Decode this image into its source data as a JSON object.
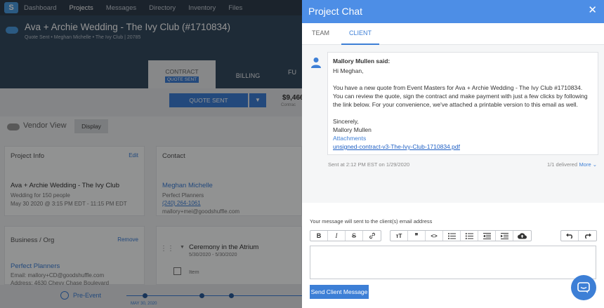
{
  "nav": {
    "items": [
      "Dashboard",
      "Projects",
      "Messages",
      "Directory",
      "Inventory",
      "Files"
    ],
    "active": "Projects"
  },
  "project": {
    "title": "Ava + Archie Wedding - The Ivy Club (#1710834)",
    "subtitle": "Quote Sent  •  Meghan Michelle  •  The Ivy Club | 20785",
    "tab_contract": "CONTRACT",
    "tab_contract_badge": "QUOTE SENT",
    "tab_billing": "BILLING",
    "tab_fu": "FU",
    "quote_button": "QUOTE SENT",
    "price": "$9,466",
    "price_sub": "Contrac",
    "vendor_view": "Vendor View",
    "display_button": "Display"
  },
  "project_info": {
    "heading": "Project Info",
    "edit": "Edit",
    "event_name": "Ava + Archie Wedding - The Ivy Club",
    "guests": "Wedding for 150 people",
    "datetime": "May 30 2020 @ 3:15 PM EDT - 11:15 PM EDT"
  },
  "contact": {
    "heading": "Contact",
    "name": "Meghan Michelle",
    "company": "Perfect Planners",
    "phone": "(240) 264-1061",
    "email": "mallory+mei@goodshuffle.com"
  },
  "business": {
    "heading": "Business / Org",
    "remove": "Remove",
    "name": "Perfect Planners",
    "email": "Email: mallory+CD@goodshuffle.com",
    "address": "Address: 4630 Chevy Chase Boulevard"
  },
  "ceremony": {
    "title": "Ceremony in the Atrium",
    "dates": "5/30/2020 - 5/30/2020",
    "item_label": "Item"
  },
  "timeline": {
    "stage": "Pre-Event",
    "date": "MAY 30, 2020"
  },
  "chat": {
    "title": "Project Chat",
    "tabs": [
      "TEAM",
      "CLIENT"
    ],
    "active_tab": "CLIENT",
    "message": {
      "sender": "Mallory Mullen said:",
      "greeting": "Hi Meghan,",
      "body": "You have a new quote from Event Masters for Ava + Archie Wedding - The Ivy Club #1710834. You can review the quote, sign the contract and make payment with just a few clicks by following the link below. For your convenience, we've attached a printable version to this email as well.",
      "closing": "Sincerely,",
      "signature": "Mallory Mullen",
      "attachments_label": "Attachments",
      "attachment": "unsigned-contract-v3-The-Ivy-Club-1710834.pdf",
      "sent_at": "Sent at 2:12 PM EST on 1/29/2020",
      "delivered": "1/1 delivered",
      "more": "More"
    },
    "compose_note": "Your message will sent to the client(s) email address",
    "send_button": "Send Client Message"
  },
  "colors": {
    "accent": "#3d7fd6",
    "header": "#4d8ee6",
    "nav_bg": "#2f3d4c"
  }
}
